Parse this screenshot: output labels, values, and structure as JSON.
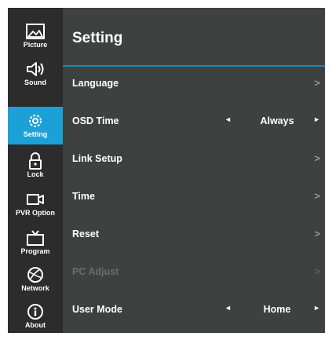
{
  "sidebar": {
    "items": [
      {
        "label": "Picture",
        "icon": "picture-icon",
        "active": false
      },
      {
        "label": "Sound",
        "icon": "speaker-icon",
        "active": false
      },
      {
        "label": "Setting",
        "icon": "gear-icon",
        "active": true
      },
      {
        "label": "Lock",
        "icon": "lock-icon",
        "active": false
      },
      {
        "label": "PVR Option",
        "icon": "video-camera-icon",
        "active": false
      },
      {
        "label": "Program",
        "icon": "tv-icon",
        "active": false
      },
      {
        "label": "Network",
        "icon": "globe-icon",
        "active": false
      },
      {
        "label": "About",
        "icon": "info-icon",
        "active": false
      }
    ]
  },
  "main": {
    "title": "Setting",
    "rows": [
      {
        "label": "Language",
        "chevron": ">"
      },
      {
        "label": "OSD Time",
        "left_arrow": "◄",
        "value": "Always",
        "right_arrow": "►"
      },
      {
        "label": "Link Setup",
        "chevron": ">"
      },
      {
        "label": "Time",
        "chevron": ">"
      },
      {
        "label": "Reset",
        "chevron": ">"
      },
      {
        "label": "PC Adjust",
        "chevron": ">",
        "disabled": true
      },
      {
        "label": "User Mode",
        "left_arrow": "◄",
        "value": "Home",
        "right_arrow": "►"
      }
    ]
  },
  "colors": {
    "accent": "#1ba0d8",
    "sidebar_bg": "#2c2c2c",
    "panel_bg": "#3f4040",
    "disabled_text": "#6d6d6d"
  }
}
